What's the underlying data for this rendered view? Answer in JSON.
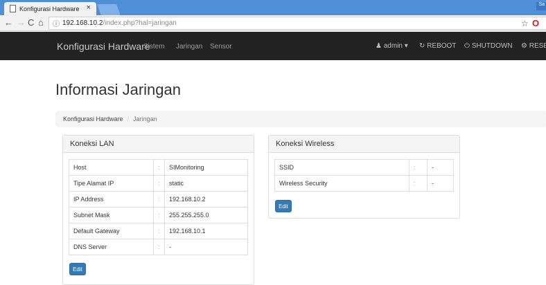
{
  "browser": {
    "tab_title": "Konfigurasi Hardware",
    "tab_close": "×",
    "url_host": "192.168.10.2",
    "url_path": "/index.php?hal=jaringan",
    "corner_label": "Sa"
  },
  "navbar": {
    "brand": "Konfigurasi Hardware",
    "links": [
      "Sistem",
      "Jaringan",
      "Sensor"
    ],
    "user": "admin",
    "reboot": "REBOOT",
    "shutdown": "SHUTDOWN",
    "reset": "RESE"
  },
  "page": {
    "title": "Informasi Jaringan",
    "breadcrumb": [
      "Konfigurasi Hardware",
      "Jaringan"
    ],
    "breadcrumb_sep": "/"
  },
  "lan": {
    "heading": "Koneksi LAN",
    "rows": [
      {
        "label": "Host",
        "value": "SIMonitoring"
      },
      {
        "label": "Tipe Alamat IP",
        "value": "static"
      },
      {
        "label": "IP Address",
        "value": "192.168.10.2"
      },
      {
        "label": "Subnet Mask",
        "value": "255.255.255.0"
      },
      {
        "label": "Default Gateway",
        "value": "192.168.10.1"
      },
      {
        "label": "DNS Server",
        "value": "-"
      }
    ],
    "edit_label": "Edit"
  },
  "wireless": {
    "heading": "Koneksi Wireless",
    "rows": [
      {
        "label": "SSID",
        "value": "-"
      },
      {
        "label": "Wireless Security",
        "value": "-"
      }
    ],
    "edit_label": "Edit"
  },
  "colon": ":"
}
